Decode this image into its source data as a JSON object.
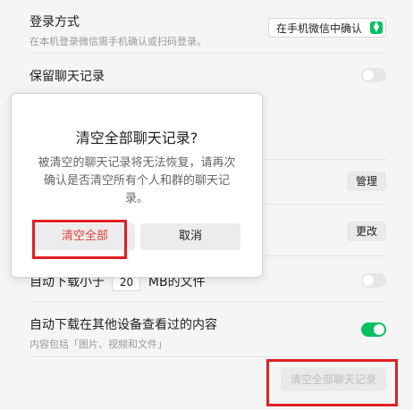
{
  "login": {
    "title": "登录方式",
    "subtitle": "在本机登录微信需手机确认或扫码登录。",
    "selected": "在手机微信中确认"
  },
  "keep_history": {
    "title": "保留聊天记录",
    "enabled": false
  },
  "manage_button": "管理",
  "change_button": "更改",
  "auto_download": {
    "prefix": "自动下载小于",
    "value": "20",
    "suffix": "MB的文件",
    "enabled": false
  },
  "auto_download_other": {
    "title": "自动下载在其他设备查看过的内容",
    "subtitle": "内容包括「图片、视频和文件」",
    "enabled": true
  },
  "clear_all_button": "清空全部聊天记录",
  "dialog": {
    "title": "清空全部聊天记录?",
    "message": "被清空的聊天记录将无法恢复，请再次确认是否清空所有个人和群的聊天记录。",
    "confirm_label": "清空全部",
    "cancel_label": "取消"
  },
  "colors": {
    "accent_green": "#07c160",
    "danger_red": "#e0403a",
    "highlight_box": "#e02020"
  },
  "icons": {
    "select_chevron": "chevron-up-down-icon"
  }
}
